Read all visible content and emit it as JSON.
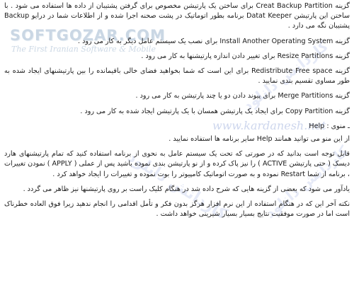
{
  "watermarks": {
    "logo": "SOFTGOZAR.COM",
    "tagline": "The First Iranian Software & Mobile",
    "site": "www.kardanesh.net",
    "arc_text": "کاردانش دانلود"
  },
  "paragraphs": {
    "p1": "گزینه Creat Backup Partition برای ساختن یک پارتیشن مخصوص برای گرفتن پشتیبان از داده ها استفاده می شود . با ساختن این پارتیشن Datat Keeper برنامه بطور اتوماتیک در پشت صحنه اجرا شده و از اطلاعات شما در درایو Backup پشتیبان نگه می دارد .",
    "p2": "گزینه Install Another Operating System برای نصب یک سیستم عامل دیگر به کار می رود .",
    "p3": "گزینه Resize Partitions برای تغییر دادن اندازه پارتیشنها به کار می رود .",
    "p4": "گزینه Redistribute Free space برای این است که شما بخواهید فضای خالی باقیمانده را بین پارتیشنهای ایجاد شده به طور مساوی تقسیم بندی نمایید .",
    "p5": "گزینه Merge Partitions برای پیوند دادن دو یا چند پارتیشن به کار می رود .",
    "p6": "گزینه Copy Partition برای ایجاد یک پارتیشن همسان با یک پارتیشن ایجاد شده به کار می رود .",
    "p7": "ـ منوی : Help",
    "p8": "از این منو می توانید همانند Help سایر برنامه ها استفاده نمایید .",
    "p9": "قابل توجه است بدانید که در صورتی که تحت یک سیستم عامل به نحوی از برنامه استفاده کنید که تمام پارتیشنهای هارد دیسک ( حتی پارتیشن ACTIVE ) را نیز پاک کرده و از نو پارتیشن بندی نموده باشید پس از عملی ( APPLY ) نمودن تغییرات ، برنامه از شما Restart نموده و به صورت اتوماتیک کامپیوتر را بوت نموده و تغییرات را ایجاد خواهد کرد .",
    "p10": "یادآور می شود که بعضی از گزینه هایی که شرح داده شد در هنگام کلیک راست بر روی پارتیشنها نیز ظاهر می گردد .",
    "p11": "نکته آخر این که در هنگام استفاده از این نرم افزار هرگز بدون فکر و تأمل اقدامی را انجام ندهید زیرا فوق العاده خطرناک است اما در صورت موفقیت نتایج بسیار بسیار شیرینی خواهد داشت ."
  }
}
